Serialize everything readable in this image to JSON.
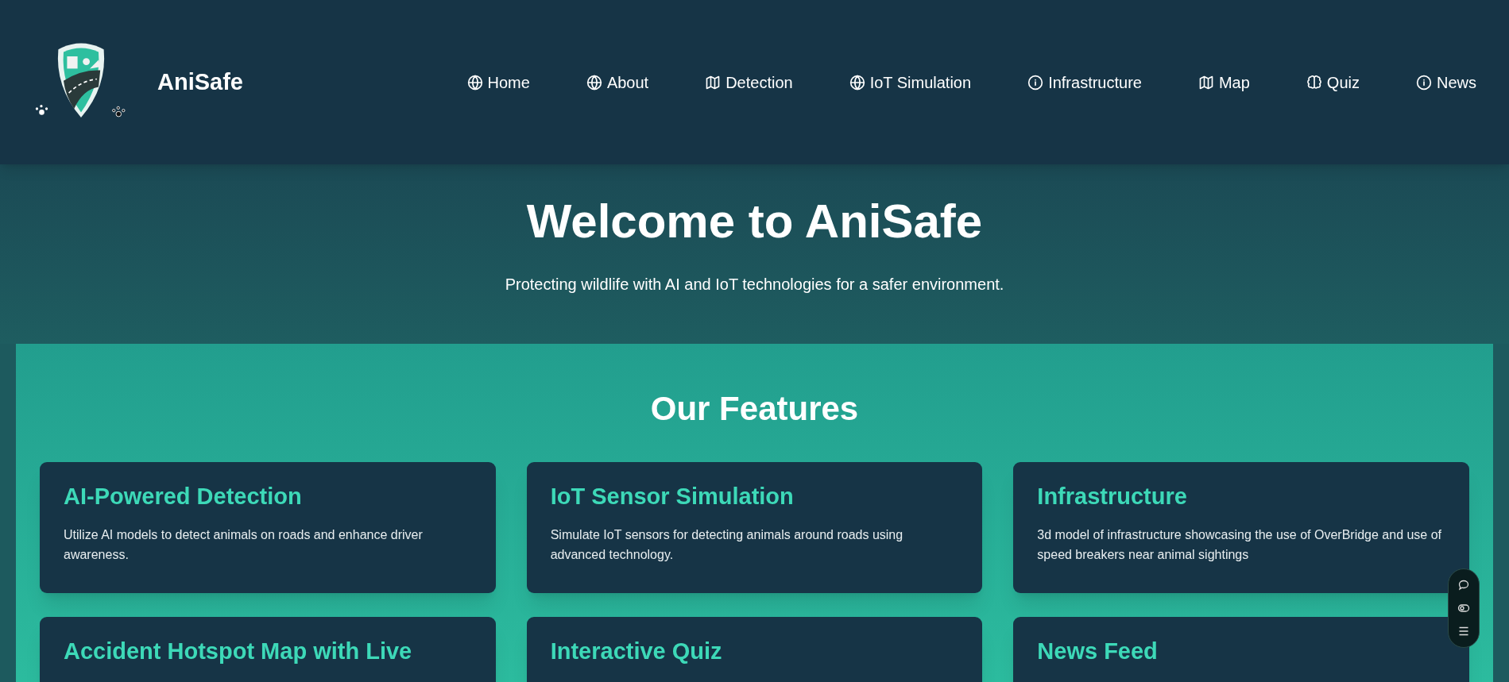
{
  "brand": {
    "name": "AniSafe"
  },
  "nav": [
    {
      "label": "Home"
    },
    {
      "label": "About"
    },
    {
      "label": "Detection"
    },
    {
      "label": "IoT Simulation"
    },
    {
      "label": "Infrastructure"
    },
    {
      "label": "Map"
    },
    {
      "label": "Quiz"
    },
    {
      "label": "News"
    }
  ],
  "hero": {
    "title": "Welcome to AniSafe",
    "subtitle": "Protecting wildlife with AI and IoT technologies for a safer environment."
  },
  "features": {
    "title": "Our Features",
    "cards": [
      {
        "title": "AI-Powered Detection",
        "text": "Utilize AI models to detect animals on roads and enhance driver awareness."
      },
      {
        "title": "IoT Sensor Simulation",
        "text": "Simulate IoT sensors for detecting animals around roads using advanced technology."
      },
      {
        "title": "Infrastructure",
        "text": "3d model of infrastructure showcasing the use of OverBridge and use of speed breakers near animal sightings"
      },
      {
        "title": "Accident Hotspot Map with Live"
      },
      {
        "title": "Interactive Quiz"
      },
      {
        "title": "News Feed"
      }
    ]
  }
}
